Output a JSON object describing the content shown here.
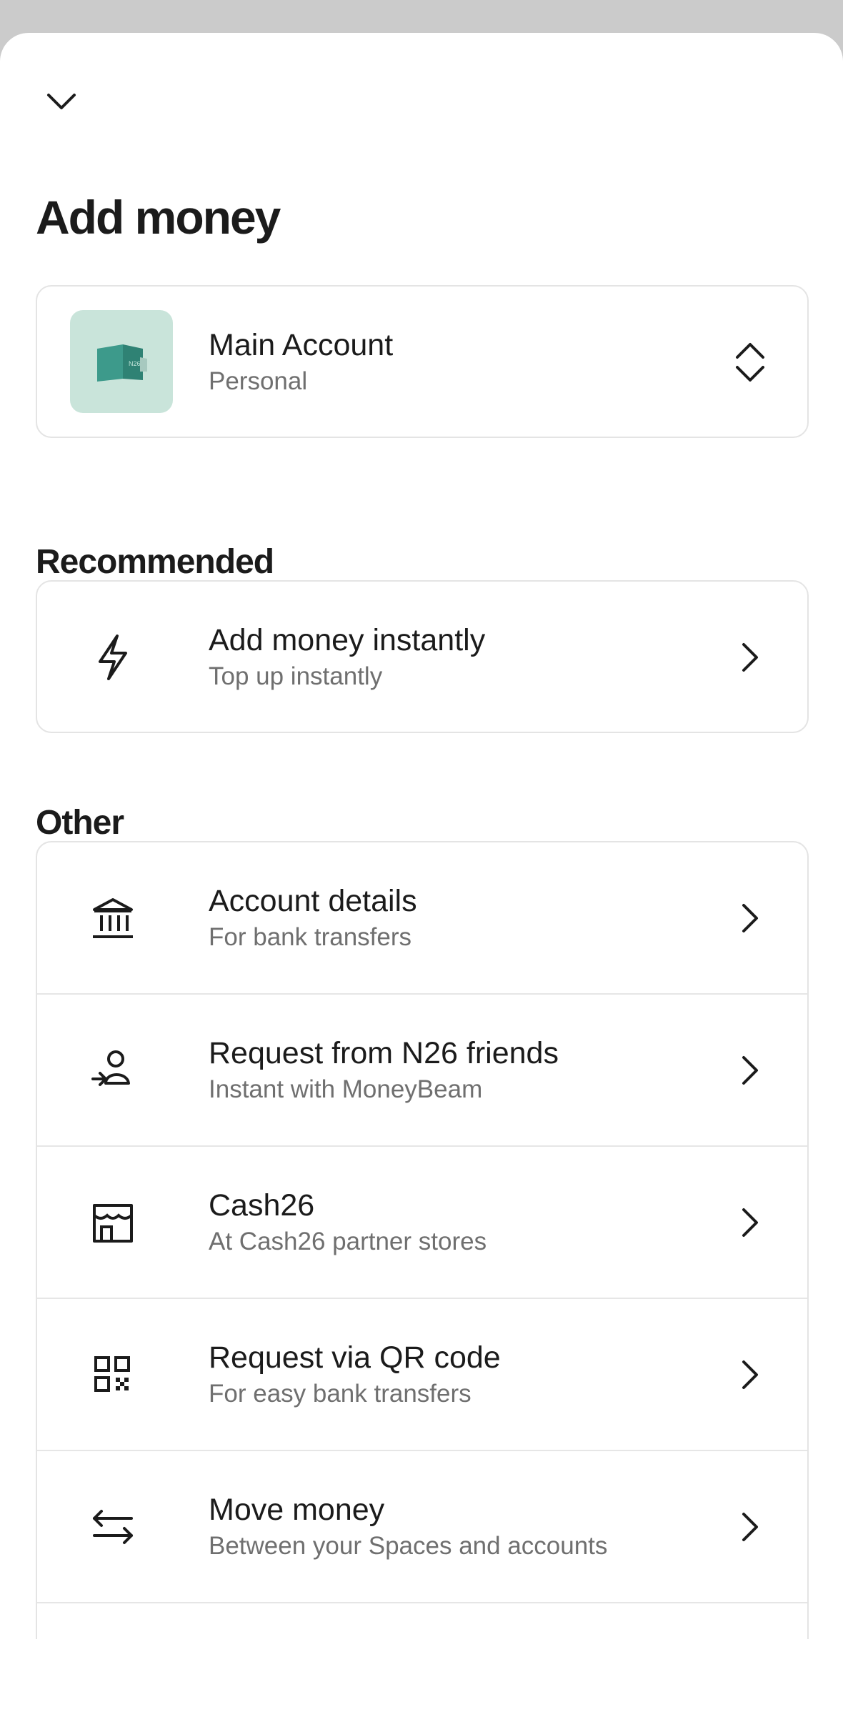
{
  "header": {
    "title": "Add money",
    "collapse_icon": "chevron-down-icon"
  },
  "account": {
    "name": "Main Account",
    "type": "Personal",
    "thumb_icon": "wallet-icon",
    "thumb_text": "N26",
    "thumb_color": "#c9e4da",
    "selector_icon": "chevron-up-down-icon"
  },
  "recommended": {
    "heading": "Recommended",
    "items": [
      {
        "title": "Add money instantly",
        "subtitle": "Top up instantly",
        "icon": "lightning-icon"
      }
    ]
  },
  "other": {
    "heading": "Other",
    "items": [
      {
        "title": "Account details",
        "subtitle": "For bank transfers",
        "icon": "bank-icon"
      },
      {
        "title": "Request from N26 friends",
        "subtitle": "Instant with MoneyBeam",
        "icon": "person-receive-icon"
      },
      {
        "title": "Cash26",
        "subtitle": "At Cash26 partner stores",
        "icon": "store-icon"
      },
      {
        "title": "Request via QR code",
        "subtitle": "For easy bank transfers",
        "icon": "qr-code-icon"
      },
      {
        "title": "Move money",
        "subtitle": "Between your Spaces and accounts",
        "icon": "transfer-arrows-icon"
      }
    ]
  },
  "colors": {
    "background_overlay": "#cbcbcb",
    "text_primary": "#1b1b1b",
    "text_secondary": "#6f6f6f",
    "border": "#e4e4e4"
  }
}
